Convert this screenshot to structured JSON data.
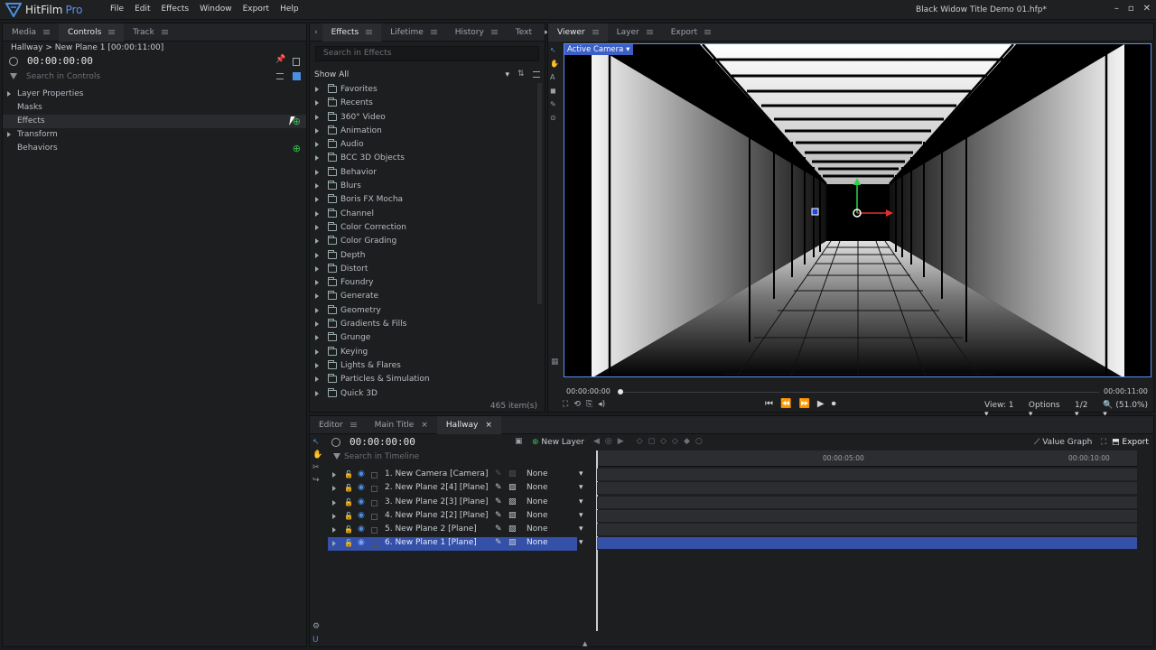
{
  "app": {
    "name": "HitFilm",
    "edition": "Pro",
    "window_title": "Black Widow Title Demo 01.hfp*",
    "menu": [
      "File",
      "Edit",
      "Effects",
      "Window",
      "Export",
      "Help"
    ]
  },
  "controls_panel": {
    "tabs": [
      "Media",
      "Controls",
      "Track"
    ],
    "breadcrumb": "Hallway > New Plane 1 [00:00:11:00]",
    "timecode": "00:00:00:00",
    "search_placeholder": "Search in Controls",
    "items": [
      {
        "label": "Layer Properties",
        "expand": true
      },
      {
        "label": "Masks",
        "expand": false
      },
      {
        "label": "Effects",
        "expand": false,
        "selected": true
      },
      {
        "label": "Transform",
        "expand": true
      },
      {
        "label": "Behaviors",
        "expand": false
      }
    ]
  },
  "effects_panel": {
    "tabs": [
      "Effects",
      "Lifetime",
      "History",
      "Text"
    ],
    "search_placeholder": "Search in Effects",
    "filter": "Show All",
    "folders": [
      "Favorites",
      "Recents",
      "360° Video",
      "Animation",
      "Audio",
      "BCC 3D Objects",
      "Behavior",
      "Blurs",
      "Boris FX Mocha",
      "Channel",
      "Color Correction",
      "Color Grading",
      "Depth",
      "Distort",
      "Foundry",
      "Generate",
      "Geometry",
      "Gradients & Fills",
      "Grunge",
      "Keying",
      "Lights & Flares",
      "Particles & Simulation",
      "Quick 3D"
    ],
    "count": "465 item(s)"
  },
  "viewer": {
    "tabs": [
      "Viewer",
      "Layer",
      "Export"
    ],
    "camera": "Active Camera",
    "time_start": "00:00:00:00",
    "time_end": "00:00:11:00",
    "view": "View: 1",
    "options": "Options",
    "resolution": "1/2",
    "zoom": "(51.0%)"
  },
  "timeline": {
    "tabs": [
      "Editor",
      "Main Title",
      "Hallway"
    ],
    "timecode": "00:00:00:00",
    "new_layer": "New Layer",
    "search_placeholder": "Search in Timeline",
    "value_graph": "Value Graph",
    "export": "Export",
    "ruler": [
      "00:00:05:00",
      "00:00:10:00"
    ],
    "layers": [
      {
        "name": "1. New Camera [Camera]",
        "parent": "None",
        "selected": false
      },
      {
        "name": "2. New Plane 2[4] [Plane]",
        "parent": "None",
        "selected": false
      },
      {
        "name": "3. New Plane 2[3] [Plane]",
        "parent": "None",
        "selected": false
      },
      {
        "name": "4. New Plane 2[2] [Plane]",
        "parent": "None",
        "selected": false
      },
      {
        "name": "5. New Plane 2 [Plane]",
        "parent": "None",
        "selected": false
      },
      {
        "name": "6. New Plane 1 [Plane]",
        "parent": "None",
        "selected": true
      }
    ]
  },
  "colors": {
    "accent": "#4a90e2",
    "selection": "#2e4fa0",
    "green": "#31c24f"
  }
}
